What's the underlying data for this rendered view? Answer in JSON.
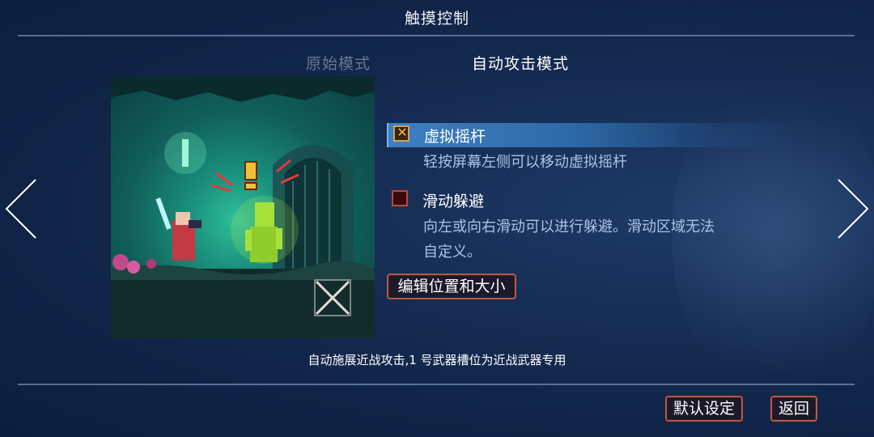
{
  "header": {
    "title": "触摸控制"
  },
  "mode_tabs": [
    {
      "label": "原始模式",
      "active": false
    },
    {
      "label": "自动攻击模式",
      "active": true
    }
  ],
  "options": [
    {
      "label": "虚拟摇杆",
      "checked": true,
      "selected": true,
      "description_lines": [
        "轻按屏幕左侧可以移动虚拟摇杆"
      ]
    },
    {
      "label": "滑动躲避",
      "checked": false,
      "selected": false,
      "description_lines": [
        "向左或向右滑动可以进行躲避。滑动区域无法",
        "自定义。"
      ]
    }
  ],
  "edit_button": {
    "label": "编辑位置和大小"
  },
  "caption": "自动施展近战攻击,1 号武器槽位为近战武器专用",
  "footer": {
    "default_label": "默认设定",
    "back_label": "返回"
  },
  "icons": {
    "prev": "chevron-left-icon",
    "next": "chevron-right-icon",
    "check": "x-check-icon",
    "close": "close-icon"
  },
  "colors": {
    "background": "#142a50",
    "selected_row": "#3e7fc4",
    "button_border": "#b85848",
    "check_gold": "#f2c13a"
  }
}
